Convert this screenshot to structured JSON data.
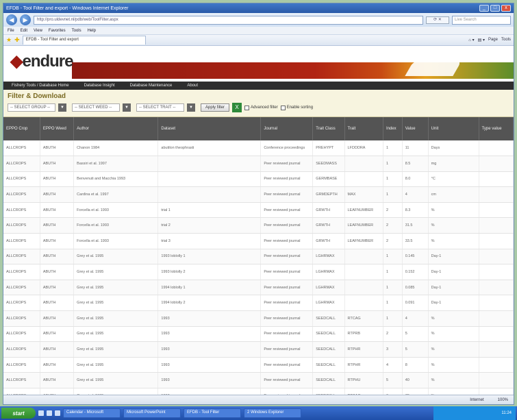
{
  "window": {
    "title": "EFDB - Tool Filter and export - Windows Internet Explorer",
    "url": "http://pro.uldevnet.nl/pdb/web/ToolFilter.aspx",
    "search_placeholder": "Live Search",
    "tab_label": "EFDB - Tool Filter and export",
    "menu": [
      "File",
      "Edit",
      "View",
      "Favorites",
      "Tools",
      "Help"
    ],
    "toolbar_right": [
      "Page",
      "Tools"
    ]
  },
  "site": {
    "logo_text": "endure",
    "nav": [
      "Fishery Tools / Database Home",
      "Database Insight",
      "Database Maintenance",
      "About"
    ]
  },
  "filter": {
    "title": "Filter & Download",
    "select_group": "-- SELECT GROUP --",
    "select_weed": "-- SELECT WEED --",
    "select_trait": "-- SELECT TRAIT --",
    "apply_label": "Apply filter",
    "advanced_label": "Advanced filter",
    "enable_sorting_label": "Enable sorting"
  },
  "table": {
    "headers": [
      "EPPO Crop",
      "EPPO Weed",
      "Author",
      "Dataset",
      "Journal",
      "Trait Class",
      "Trait",
      "Index",
      "Value",
      "Unit",
      "Type value"
    ],
    "rows": [
      [
        "ALLCROPS",
        "ABUTH",
        "Chanon 1984",
        "abutilon theophrasti",
        "Conference proceedings",
        "PREHYPT",
        "LFDDDRA",
        "1",
        "11",
        "Days",
        ""
      ],
      [
        "ALLCROPS",
        "ABUTH",
        "Bassiri et al. 1997",
        "",
        "Peer reviewed journal",
        "SEEDMASS",
        "",
        "1",
        "8.5",
        "mg",
        ""
      ],
      [
        "ALLCROPS",
        "ABUTH",
        "Benvenuti and Macchia 1993",
        "",
        "Peer reviewed journal",
        "GERMBASE",
        "",
        "1",
        "8.0",
        "°C",
        ""
      ],
      [
        "ALLCROPS",
        "ABUTH",
        "Cardina et al. 1997",
        "",
        "Peer reviewed journal",
        "GRMDEPTH",
        "MAX",
        "1",
        "4",
        "cm",
        ""
      ],
      [
        "ALLCROPS",
        "ABUTH",
        "Forcella et al. 1993",
        "trial 1",
        "Peer reviewed journal",
        "GRWTH",
        "LEAFNUMBER",
        "2",
        "8.3",
        "%",
        ""
      ],
      [
        "ALLCROPS",
        "ABUTH",
        "Forcella et al. 1993",
        "trial 2",
        "Peer reviewed journal",
        "GRWTH",
        "LEAFNUMBER",
        "2",
        "31.5",
        "%",
        ""
      ],
      [
        "ALLCROPS",
        "ABUTH",
        "Forcella et al. 1993",
        "trial 3",
        "Peer reviewed journal",
        "GRWTH",
        "LEAFNUMBER",
        "2",
        "33.5",
        "%",
        ""
      ],
      [
        "ALLCROPS",
        "ABUTH",
        "Grey et al. 1995",
        "1993 loblolly 1",
        "Peer reviewed journal",
        "LGHRMAX",
        "",
        "1",
        "0.145",
        "Day-1",
        ""
      ],
      [
        "ALLCROPS",
        "ABUTH",
        "Grey et al. 1995",
        "1993 loblolly 2",
        "Peer reviewed journal",
        "LGHRMAX",
        "",
        "1",
        "0.152",
        "Day-1",
        ""
      ],
      [
        "ALLCROPS",
        "ABUTH",
        "Grey et al. 1995",
        "1994 loblolly 1",
        "Peer reviewed journal",
        "LGHRMAX",
        "",
        "1",
        "0.085",
        "Day-1",
        ""
      ],
      [
        "ALLCROPS",
        "ABUTH",
        "Grey et al. 1995",
        "1994 loblolly 2",
        "Peer reviewed journal",
        "LGHRMAX",
        "",
        "1",
        "0.091",
        "Day-1",
        ""
      ],
      [
        "ALLCROPS",
        "ABUTH",
        "Grey et al. 1995",
        "1993",
        "Peer reviewed journal",
        "SEEDCALL",
        "RTCAG",
        "1",
        "4",
        "%",
        ""
      ],
      [
        "ALLCROPS",
        "ABUTH",
        "Grey et al. 1995",
        "1993",
        "Peer reviewed journal",
        "SEEDCALL",
        "RTPRB",
        "2",
        "5",
        "%",
        ""
      ],
      [
        "ALLCROPS",
        "ABUTH",
        "Grey et al. 1995",
        "1993",
        "Peer reviewed journal",
        "SEEDCALL",
        "RTPHR",
        "3",
        "5",
        "%",
        ""
      ],
      [
        "ALLCROPS",
        "ABUTH",
        "Grey et al. 1995",
        "1993",
        "Peer reviewed journal",
        "SEEDCALL",
        "RTPHR",
        "4",
        "8",
        "%",
        ""
      ],
      [
        "ALLCROPS",
        "ABUTH",
        "Grey et al. 1995",
        "1993",
        "Peer reviewed journal",
        "SEEDCALL",
        "RTPHU",
        "5",
        "40",
        "%",
        ""
      ],
      [
        "ALLCROPS",
        "ABUTH",
        "Grey et al. 1995",
        "1993",
        "Peer reviewed journal",
        "SEEDCALL",
        "RTCAG",
        "6",
        "70",
        "%",
        ""
      ]
    ]
  },
  "status": {
    "zone": "Internet",
    "zoom": "100%"
  },
  "taskbar": {
    "start_label": "start",
    "tasks": [
      "Calendar - Microsoft",
      "Microsoft PowerPoint",
      "EFDB - Tool Filter",
      "2 Windows Explorer"
    ],
    "clock": "11:24"
  }
}
